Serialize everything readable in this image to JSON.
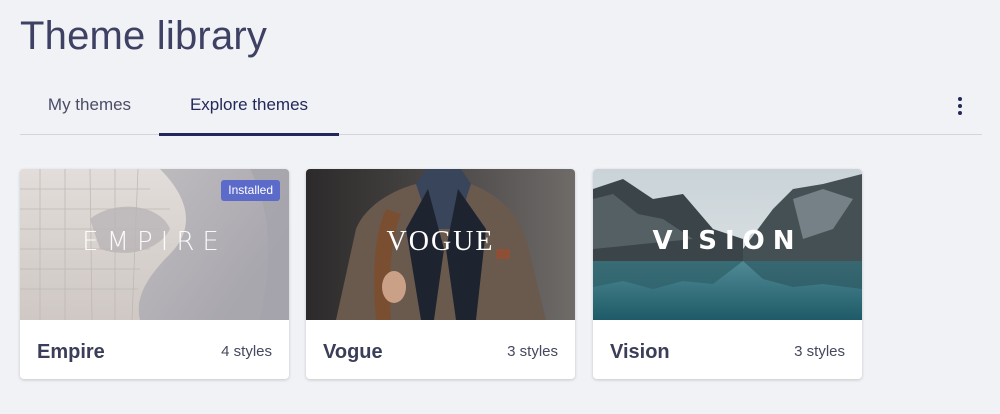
{
  "page": {
    "title": "Theme library"
  },
  "tabs": [
    {
      "label": "My themes",
      "active": false
    },
    {
      "label": "Explore themes",
      "active": true
    }
  ],
  "colors": {
    "accent": "#23285a",
    "badge": "#5c6bc9",
    "background": "#f1f2f6"
  },
  "themes": [
    {
      "name": "Empire",
      "styles": "4 styles",
      "thumb_word": "EMPIRE",
      "badge": "Installed"
    },
    {
      "name": "Vogue",
      "styles": "3 styles",
      "thumb_word": "VOGUE"
    },
    {
      "name": "Vision",
      "styles": "3 styles",
      "thumb_word": "VISION"
    }
  ],
  "toolbar": {
    "more_icon": "more-vertical-icon"
  }
}
